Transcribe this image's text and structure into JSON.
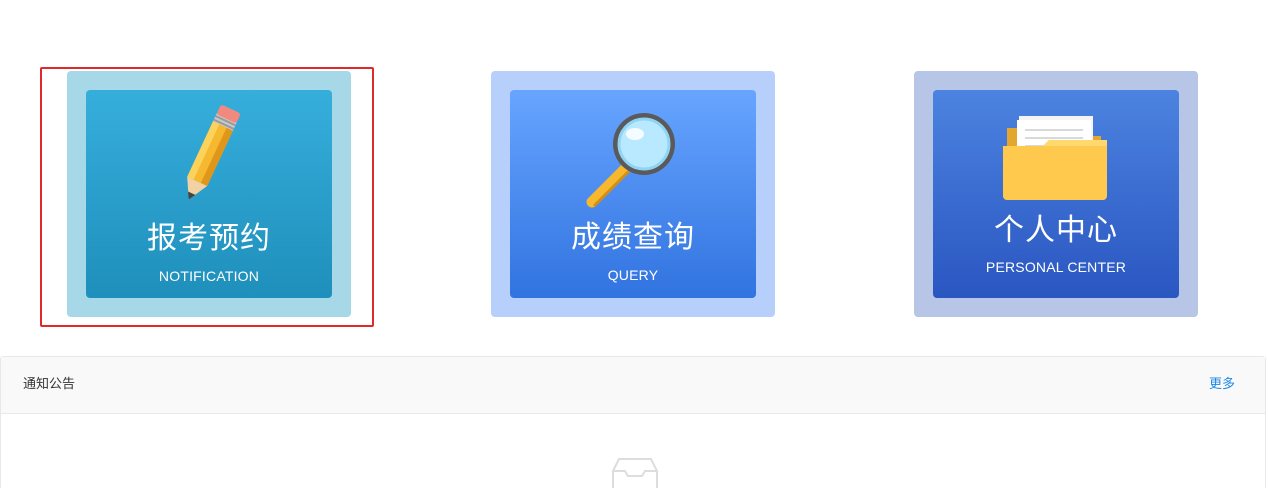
{
  "cards": [
    {
      "title": "报考预约",
      "subtitle": "NOTIFICATION",
      "icon": "pencil-icon",
      "selected": true
    },
    {
      "title": "成绩查询",
      "subtitle": "QUERY",
      "icon": "magnifier-icon",
      "selected": false
    },
    {
      "title": "个人中心",
      "subtitle": "PERSONAL CENTER",
      "icon": "folder-icon",
      "selected": false
    }
  ],
  "notices": {
    "title": "通知公告",
    "more_label": "更多",
    "empty_icon": "empty-box-icon"
  },
  "colors": {
    "selection_border": "#e02a2a",
    "more_link": "#1e88e5"
  }
}
